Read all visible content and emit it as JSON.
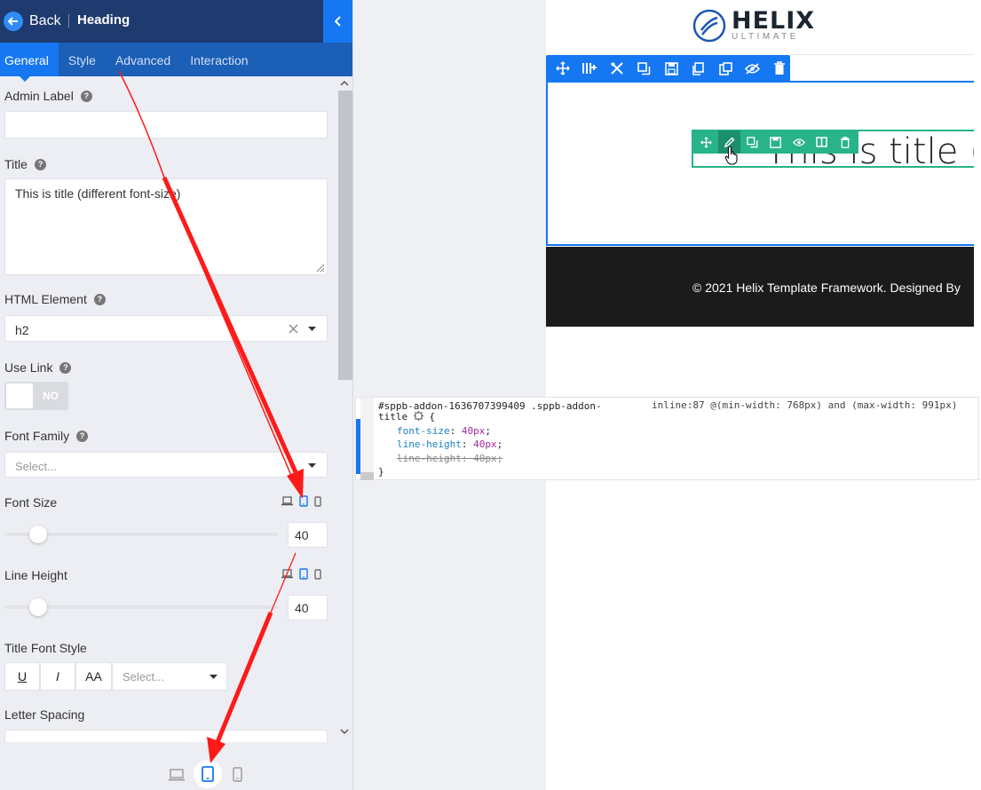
{
  "panel": {
    "back_label": "Back",
    "title": "Heading",
    "tabs": [
      {
        "label": "General",
        "active": true
      },
      {
        "label": "Style",
        "active": false
      },
      {
        "label": "Advanced",
        "active": false
      },
      {
        "label": "Interaction",
        "active": false
      }
    ],
    "admin_label": {
      "label": "Admin Label",
      "value": ""
    },
    "title_field": {
      "label": "Title",
      "value": "This is title (different font-size)"
    },
    "html_element": {
      "label": "HTML Element",
      "value": "h2"
    },
    "use_link": {
      "label": "Use Link",
      "toggle_text": "NO"
    },
    "font_family": {
      "label": "Font Family",
      "placeholder": "Select..."
    },
    "font_size": {
      "label": "Font Size",
      "value": "40",
      "active_device": "tablet"
    },
    "line_height": {
      "label": "Line Height",
      "value": "40",
      "active_device": "tablet"
    },
    "title_font_style": {
      "label": "Title Font Style",
      "buttons": [
        "U",
        "I",
        "AA"
      ],
      "placeholder": "Select..."
    },
    "letter_spacing": {
      "label": "Letter Spacing"
    },
    "footer_active_device": "tablet"
  },
  "preview": {
    "logo_main": "HELIX",
    "logo_sub": "ULTIMATE",
    "heading_text": "This is title (different font-size)",
    "footer_text": "© 2021 Helix Template Framework. Designed By"
  },
  "devtools": {
    "selector_line1": "#sppb-addon-1636707399409 .sppb-addon-",
    "selector_line2": "title",
    "source": "inline:87 @(min-width: 768px) and (max-width: 991px)",
    "rules": [
      {
        "prop": "font-size",
        "value": "40px",
        "overridden": false
      },
      {
        "prop": "line-height",
        "value": "40px",
        "overridden": false
      },
      {
        "prop": "line-height",
        "value": "40px",
        "overridden": true
      }
    ],
    "close_brace": "}"
  },
  "colors": {
    "header_bg": "#1e3a6e",
    "accent_blue": "#1677f2",
    "addon_green": "#28b38a",
    "arrow_red": "#ff1a1a"
  }
}
